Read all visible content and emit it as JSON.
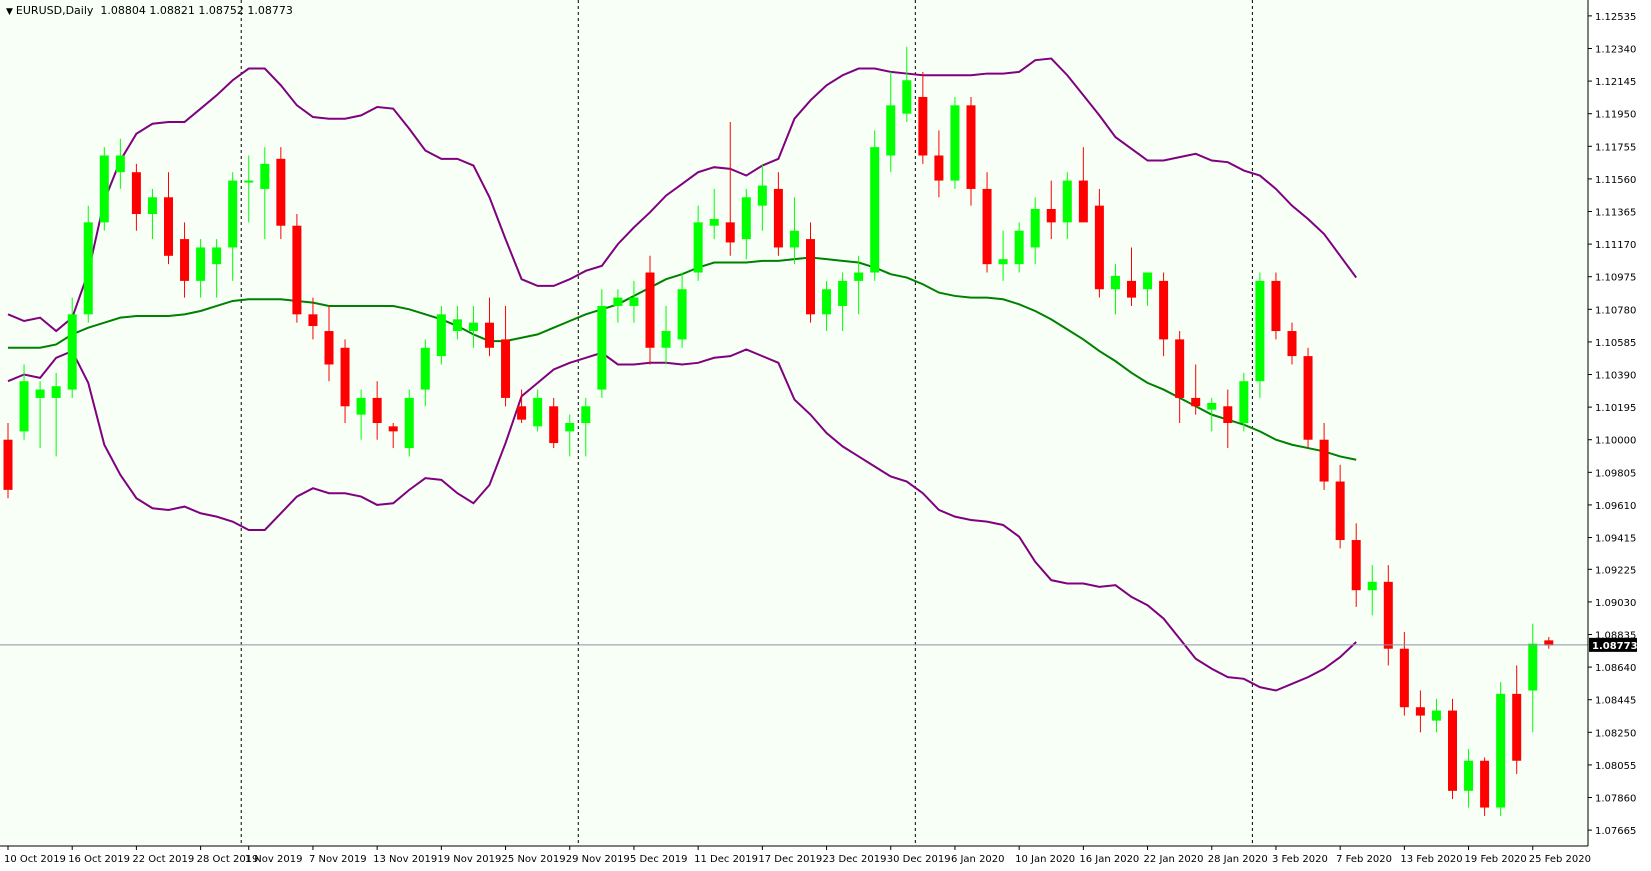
{
  "header": {
    "symbol": "EURUSD,Daily",
    "ohlc": "1.08804 1.08821 1.08752 1.08773"
  },
  "colors": {
    "background": "#f7fff7",
    "bull_candle": "#00ff00",
    "bear_candle": "#ff0000",
    "upper_band": "#800080",
    "moving_average": "#008000",
    "current_price_line": "#8c94a3",
    "current_price_label_bg": "#000000",
    "grid_separator": "#000000"
  },
  "chart_data": {
    "type": "candlestick",
    "title": "EURUSD,Daily",
    "ylim": [
      1.0757,
      1.1263
    ],
    "y_ticks": [
      "1.12535",
      "1.12340",
      "1.12145",
      "1.11950",
      "1.11755",
      "1.11560",
      "1.11365",
      "1.11170",
      "1.10975",
      "1.10780",
      "1.10585",
      "1.10390",
      "1.10195",
      "1.10000",
      "1.09805",
      "1.09610",
      "1.09415",
      "1.09225",
      "1.09030",
      "1.08835",
      "1.08640",
      "1.08445",
      "1.08250",
      "1.08055",
      "1.07860",
      "1.07665"
    ],
    "x_labels": [
      "10 Oct 2019",
      "16 Oct 2019",
      "22 Oct 2019",
      "28 Oct 2019",
      "1 Nov 2019",
      "7 Nov 2019",
      "13 Nov 2019",
      "19 Nov 2019",
      "25 Nov 2019",
      "29 Nov 2019",
      "5 Dec 2019",
      "11 Dec 2019",
      "17 Dec 2019",
      "23 Dec 2019",
      "30 Dec 2019",
      "6 Jan 2020",
      "10 Jan 2020",
      "16 Jan 2020",
      "22 Jan 2020",
      "28 Jan 2020",
      "3 Feb 2020",
      "7 Feb 2020",
      "13 Feb 2020",
      "19 Feb 2020",
      "25 Feb 2020"
    ],
    "x_label_bars": [
      0,
      4,
      8,
      12,
      15,
      19,
      23,
      27,
      31,
      35,
      39,
      43,
      47,
      51,
      55,
      59,
      63,
      67,
      71,
      75,
      79,
      83,
      87,
      91,
      95
    ],
    "period_separators_bars": [
      15,
      36,
      57,
      78
    ],
    "current_price": "1.08773",
    "candles": [
      [
        1.1,
        1.101,
        1.0965,
        1.097
      ],
      [
        1.1005,
        1.1045,
        1.1,
        1.1035
      ],
      [
        1.1025,
        1.1035,
        1.0995,
        1.103
      ],
      [
        1.1025,
        1.104,
        1.099,
        1.1032
      ],
      [
        1.103,
        1.1085,
        1.1025,
        1.1075
      ],
      [
        1.1075,
        1.114,
        1.107,
        1.113
      ],
      [
        1.113,
        1.1175,
        1.1125,
        1.117
      ],
      [
        1.116,
        1.118,
        1.115,
        1.117
      ],
      [
        1.116,
        1.1165,
        1.1125,
        1.1135
      ],
      [
        1.1135,
        1.115,
        1.112,
        1.1145
      ],
      [
        1.1145,
        1.116,
        1.1105,
        1.111
      ],
      [
        1.112,
        1.113,
        1.1085,
        1.1095
      ],
      [
        1.1095,
        1.112,
        1.1085,
        1.1115
      ],
      [
        1.1105,
        1.112,
        1.1085,
        1.1115
      ],
      [
        1.1115,
        1.116,
        1.1095,
        1.1155
      ],
      [
        1.1155,
        1.117,
        1.113,
        1.1155
      ],
      [
        1.115,
        1.1175,
        1.112,
        1.1165
      ],
      [
        1.1168,
        1.1175,
        1.112,
        1.1128
      ],
      [
        1.1128,
        1.1135,
        1.107,
        1.1075
      ],
      [
        1.1075,
        1.1085,
        1.106,
        1.1068
      ],
      [
        1.1065,
        1.108,
        1.1035,
        1.1045
      ],
      [
        1.1055,
        1.106,
        1.101,
        1.102
      ],
      [
        1.1015,
        1.103,
        1.1,
        1.1025
      ],
      [
        1.1025,
        1.1035,
        1.1,
        1.101
      ],
      [
        1.1008,
        1.101,
        1.0995,
        1.1005
      ],
      [
        1.0995,
        1.103,
        1.099,
        1.1025
      ],
      [
        1.103,
        1.106,
        1.102,
        1.1055
      ],
      [
        1.105,
        1.108,
        1.1045,
        1.1075
      ],
      [
        1.1065,
        1.108,
        1.106,
        1.1072
      ],
      [
        1.1065,
        1.108,
        1.1055,
        1.107
      ],
      [
        1.107,
        1.1085,
        1.105,
        1.1055
      ],
      [
        1.106,
        1.108,
        1.102,
        1.1025
      ],
      [
        1.102,
        1.103,
        1.101,
        1.1012
      ],
      [
        1.1008,
        1.103,
        1.1005,
        1.1025
      ],
      [
        1.102,
        1.1025,
        1.0995,
        1.0998
      ],
      [
        1.1005,
        1.1015,
        1.099,
        1.101
      ],
      [
        1.101,
        1.1025,
        1.099,
        1.102
      ],
      [
        1.103,
        1.109,
        1.1025,
        1.108
      ],
      [
        1.108,
        1.109,
        1.107,
        1.1085
      ],
      [
        1.108,
        1.1095,
        1.107,
        1.1085
      ],
      [
        1.11,
        1.111,
        1.1045,
        1.1055
      ],
      [
        1.1055,
        1.108,
        1.1045,
        1.1065
      ],
      [
        1.106,
        1.11,
        1.1055,
        1.109
      ],
      [
        1.11,
        1.114,
        1.1095,
        1.113
      ],
      [
        1.1128,
        1.115,
        1.112,
        1.1132
      ],
      [
        1.113,
        1.119,
        1.111,
        1.1118
      ],
      [
        1.112,
        1.115,
        1.1108,
        1.1145
      ],
      [
        1.114,
        1.1165,
        1.1125,
        1.1152
      ],
      [
        1.115,
        1.116,
        1.111,
        1.1115
      ],
      [
        1.1115,
        1.1145,
        1.1105,
        1.1125
      ],
      [
        1.112,
        1.113,
        1.107,
        1.1075
      ],
      [
        1.1075,
        1.1095,
        1.1065,
        1.109
      ],
      [
        1.108,
        1.11,
        1.1065,
        1.1095
      ],
      [
        1.1095,
        1.111,
        1.1075,
        1.11
      ],
      [
        1.11,
        1.1185,
        1.1095,
        1.1175
      ],
      [
        1.117,
        1.122,
        1.116,
        1.12
      ],
      [
        1.1195,
        1.1235,
        1.119,
        1.1215
      ],
      [
        1.1205,
        1.122,
        1.1165,
        1.117
      ],
      [
        1.117,
        1.1185,
        1.1145,
        1.1155
      ],
      [
        1.1155,
        1.1205,
        1.115,
        1.12
      ],
      [
        1.12,
        1.1205,
        1.114,
        1.115
      ],
      [
        1.115,
        1.116,
        1.11,
        1.1105
      ],
      [
        1.1105,
        1.1125,
        1.1095,
        1.1108
      ],
      [
        1.1105,
        1.113,
        1.11,
        1.1125
      ],
      [
        1.1115,
        1.1145,
        1.1105,
        1.1138
      ],
      [
        1.1138,
        1.1155,
        1.112,
        1.113
      ],
      [
        1.113,
        1.116,
        1.112,
        1.1155
      ],
      [
        1.1155,
        1.1175,
        1.1135,
        1.113
      ],
      [
        1.114,
        1.115,
        1.1085,
        1.109
      ],
      [
        1.109,
        1.1105,
        1.1075,
        1.1098
      ],
      [
        1.1095,
        1.1115,
        1.108,
        1.1085
      ],
      [
        1.109,
        1.11,
        1.108,
        1.11
      ],
      [
        1.1095,
        1.11,
        1.105,
        1.106
      ],
      [
        1.106,
        1.1065,
        1.101,
        1.1025
      ],
      [
        1.1025,
        1.1045,
        1.1015,
        1.102
      ],
      [
        1.1018,
        1.1025,
        1.1005,
        1.1022
      ],
      [
        1.102,
        1.103,
        1.0995,
        1.101
      ],
      [
        1.101,
        1.104,
        1.1005,
        1.1035
      ],
      [
        1.1035,
        1.11,
        1.1025,
        1.1095
      ],
      [
        1.1095,
        1.11,
        1.106,
        1.1065
      ],
      [
        1.1065,
        1.107,
        1.1045,
        1.105
      ],
      [
        1.105,
        1.1055,
        1.0995,
        1.1
      ],
      [
        1.1,
        1.101,
        1.097,
        1.0975
      ],
      [
        1.0975,
        1.0985,
        1.0935,
        1.094
      ],
      [
        1.094,
        1.095,
        1.09,
        1.091
      ],
      [
        1.091,
        1.0925,
        1.0895,
        1.0915
      ],
      [
        1.0915,
        1.0925,
        1.0865,
        1.0875
      ],
      [
        1.0875,
        1.0885,
        1.0835,
        1.084
      ],
      [
        1.084,
        1.085,
        1.0825,
        1.0835
      ],
      [
        1.0832,
        1.0845,
        1.0825,
        1.0838
      ],
      [
        1.0838,
        1.0845,
        1.0785,
        1.079
      ],
      [
        1.079,
        1.0815,
        1.078,
        1.0808
      ],
      [
        1.0808,
        1.081,
        1.0775,
        1.078
      ],
      [
        1.078,
        1.0855,
        1.0775,
        1.0848
      ],
      [
        1.0848,
        1.0865,
        1.08,
        1.0808
      ],
      [
        1.085,
        1.089,
        1.0825,
        1.0878
      ],
      [
        1.088,
        1.0882,
        1.0875,
        1.0877
      ]
    ],
    "bands": {
      "upper": [
        1.1075,
        1.1071,
        1.1073,
        1.1065,
        1.1073,
        1.11,
        1.1143,
        1.1167,
        1.1183,
        1.1189,
        1.119,
        1.119,
        1.1198,
        1.1206,
        1.1215,
        1.1222,
        1.1222,
        1.1212,
        1.12,
        1.1193,
        1.1192,
        1.1192,
        1.1194,
        1.1199,
        1.1198,
        1.1186,
        1.1173,
        1.1168,
        1.1168,
        1.1164,
        1.1145,
        1.112,
        1.1096,
        1.1092,
        1.1092,
        1.1096,
        1.1101,
        1.1104,
        1.1117,
        1.1127,
        1.1136,
        1.1146,
        1.1153,
        1.116,
        1.1163,
        1.1162,
        1.1158,
        1.1164,
        1.1168,
        1.1192,
        1.1203,
        1.1212,
        1.1218,
        1.1222,
        1.1222,
        1.122,
        1.1219,
        1.1218,
        1.1218,
        1.1218,
        1.1218,
        1.1219,
        1.1219,
        1.122,
        1.1227,
        1.1228,
        1.1218,
        1.1206,
        1.1194,
        1.1181,
        1.1174,
        1.1167,
        1.1167,
        1.1169,
        1.1171,
        1.1167,
        1.1166,
        1.1161,
        1.1158,
        1.115,
        1.114,
        1.1132,
        1.1123,
        1.111,
        1.1097
      ],
      "middle": [
        1.1055,
        1.1055,
        1.1055,
        1.1057,
        1.1063,
        1.1067,
        1.107,
        1.1073,
        1.1074,
        1.1074,
        1.1074,
        1.1075,
        1.1077,
        1.108,
        1.1083,
        1.1084,
        1.1084,
        1.1084,
        1.1083,
        1.1082,
        1.108,
        1.108,
        1.108,
        1.108,
        1.108,
        1.1078,
        1.1075,
        1.1072,
        1.1068,
        1.1063,
        1.1059,
        1.1059,
        1.1061,
        1.1063,
        1.1067,
        1.1071,
        1.1075,
        1.1078,
        1.1081,
        1.1086,
        1.1091,
        1.1096,
        1.1099,
        1.1103,
        1.1106,
        1.1106,
        1.1106,
        1.1107,
        1.1107,
        1.1108,
        1.1109,
        1.1108,
        1.1107,
        1.1106,
        1.1103,
        1.1099,
        1.1097,
        1.1093,
        1.1088,
        1.1086,
        1.1085,
        1.1085,
        1.1084,
        1.1081,
        1.1077,
        1.1072,
        1.1066,
        1.106,
        1.1053,
        1.1047,
        1.104,
        1.1034,
        1.103,
        1.1025,
        1.102,
        1.1015,
        1.1012,
        1.1009,
        1.1005,
        1.1,
        1.0997,
        1.0995,
        1.0993,
        1.099,
        1.0988
      ]
    }
  }
}
